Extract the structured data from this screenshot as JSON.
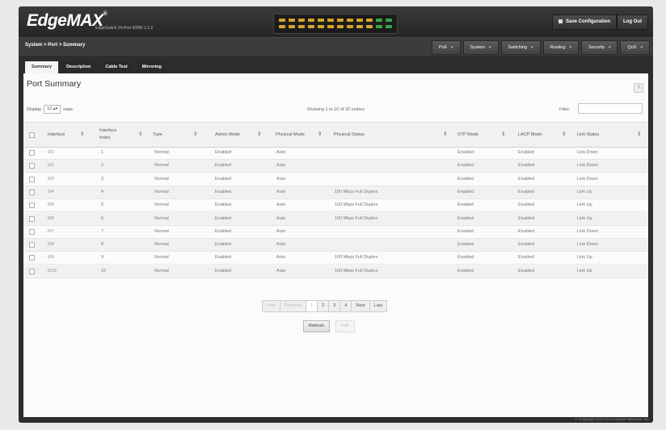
{
  "header": {
    "logo": "EdgeMAX",
    "logo_mark": "®",
    "model": "EdgeSwitch 24-Port 500W 1.1.2",
    "save_config_label": "Save Configuration",
    "logout_label": "Log Out"
  },
  "breadcrumb": "System > Port > Summary",
  "menus": [
    {
      "label": "PoE"
    },
    {
      "label": "System"
    },
    {
      "label": "Switching"
    },
    {
      "label": "Routing"
    },
    {
      "label": "Security"
    },
    {
      "label": "QoS"
    }
  ],
  "tabs": [
    {
      "label": "Summary",
      "active": true
    },
    {
      "label": "Description",
      "active": false
    },
    {
      "label": "Cable Test",
      "active": false
    },
    {
      "label": "Mirroring",
      "active": false
    }
  ],
  "page": {
    "title": "Port Summary",
    "help_label": "?",
    "display_label": "Display",
    "display_value": "10",
    "rows_label": "rows",
    "showing": "Showing 1 to 10 of 32 entries",
    "filter_label": "Filter:",
    "filter_value": ""
  },
  "table": {
    "headers": {
      "interface": "Interface",
      "index_line1": "Interface",
      "index_line2": "Index",
      "type": "Type",
      "admin": "Admin Mode",
      "physical_mode": "Physical Mode",
      "physical_status": "Physical Status",
      "stp": "STP Mode",
      "lacp": "LACP Mode",
      "link": "Link Status"
    },
    "rows": [
      {
        "interface": "0/1",
        "index": "1",
        "type": "Normal",
        "admin": "Enabled",
        "physical_mode": "Auto",
        "physical_status": "",
        "stp": "Enabled",
        "lacp": "Enabled",
        "link": "Link Down"
      },
      {
        "interface": "0/2",
        "index": "2",
        "type": "Normal",
        "admin": "Enabled",
        "physical_mode": "Auto",
        "physical_status": "",
        "stp": "Enabled",
        "lacp": "Enabled",
        "link": "Link Down"
      },
      {
        "interface": "0/3",
        "index": "3",
        "type": "Normal",
        "admin": "Enabled",
        "physical_mode": "Auto",
        "physical_status": "",
        "stp": "Enabled",
        "lacp": "Enabled",
        "link": "Link Down"
      },
      {
        "interface": "0/4",
        "index": "4",
        "type": "Normal",
        "admin": "Enabled",
        "physical_mode": "Auto",
        "physical_status": "100 Mbps Full Duplex",
        "stp": "Enabled",
        "lacp": "Enabled",
        "link": "Link Up"
      },
      {
        "interface": "0/5",
        "index": "5",
        "type": "Normal",
        "admin": "Enabled",
        "physical_mode": "Auto",
        "physical_status": "100 Mbps Full Duplex",
        "stp": "Enabled",
        "lacp": "Enabled",
        "link": "Link Up"
      },
      {
        "interface": "0/6",
        "index": "6",
        "type": "Normal",
        "admin": "Enabled",
        "physical_mode": "Auto",
        "physical_status": "100 Mbps Full Duplex",
        "stp": "Enabled",
        "lacp": "Enabled",
        "link": "Link Up"
      },
      {
        "interface": "0/7",
        "index": "7",
        "type": "Normal",
        "admin": "Enabled",
        "physical_mode": "Auto",
        "physical_status": "",
        "stp": "Enabled",
        "lacp": "Enabled",
        "link": "Link Down"
      },
      {
        "interface": "0/8",
        "index": "8",
        "type": "Normal",
        "admin": "Enabled",
        "physical_mode": "Auto",
        "physical_status": "",
        "stp": "Enabled",
        "lacp": "Enabled",
        "link": "Link Down"
      },
      {
        "interface": "0/9",
        "index": "9",
        "type": "Normal",
        "admin": "Enabled",
        "physical_mode": "Auto",
        "physical_status": "100 Mbps Full Duplex",
        "stp": "Enabled",
        "lacp": "Enabled",
        "link": "Link Up"
      },
      {
        "interface": "0/10",
        "index": "10",
        "type": "Normal",
        "admin": "Enabled",
        "physical_mode": "Auto",
        "physical_status": "100 Mbps Full Duplex",
        "stp": "Enabled",
        "lacp": "Enabled",
        "link": "Link Up"
      }
    ]
  },
  "pagination": {
    "first": "First",
    "previous": "Previous",
    "pages": [
      "1",
      "2",
      "3",
      "4"
    ],
    "current": "1",
    "next": "Next",
    "last": "Last"
  },
  "actions": {
    "refresh": "Refresh",
    "edit": "Edit"
  },
  "copyright": "© Copyright 2013-2014 Ubiquiti Networks, Inc.",
  "colors": {
    "accent": "#d7a42a",
    "port_green": "#37a54a",
    "header_bg": "#2d2d2d"
  }
}
